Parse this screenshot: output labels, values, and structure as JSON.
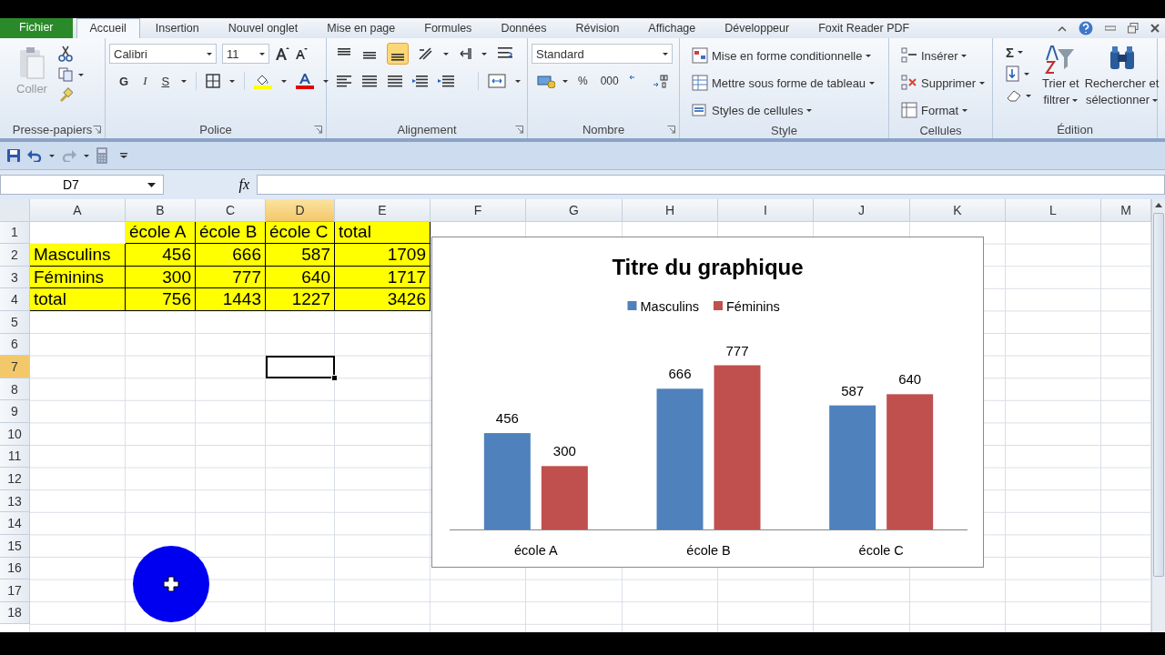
{
  "tabs": [
    {
      "label": "Fichier",
      "kind": "file",
      "selected": false
    },
    {
      "label": "Accueil",
      "kind": "tab",
      "selected": true
    },
    {
      "label": "Insertion",
      "kind": "tab",
      "selected": false
    },
    {
      "label": "Nouvel onglet",
      "kind": "tab",
      "selected": false
    },
    {
      "label": "Mise en page",
      "kind": "tab",
      "selected": false
    },
    {
      "label": "Formules",
      "kind": "tab",
      "selected": false
    },
    {
      "label": "Données",
      "kind": "tab",
      "selected": false
    },
    {
      "label": "Révision",
      "kind": "tab",
      "selected": false
    },
    {
      "label": "Affichage",
      "kind": "tab",
      "selected": false
    },
    {
      "label": "Développeur",
      "kind": "tab",
      "selected": false
    },
    {
      "label": "Foxit Reader PDF",
      "kind": "tab",
      "selected": false
    }
  ],
  "ribbon": [
    {
      "kind": "clipboard",
      "label": "Presse-papiers",
      "paste": {
        "label": "Coller",
        "disabled": true
      }
    },
    {
      "kind": "font",
      "label": "Police",
      "font": "Calibri",
      "size": "11",
      "styles": [
        "G",
        "I",
        "S"
      ]
    },
    {
      "kind": "alignment",
      "label": "Alignement"
    },
    {
      "kind": "number",
      "label": "Nombre",
      "format": "Standard",
      "symbols": [
        "%",
        "000"
      ]
    },
    {
      "kind": "styles",
      "label": "Style",
      "items": [
        "Mise en forme conditionnelle",
        "Mettre sous forme de tableau",
        "Styles de cellules"
      ]
    },
    {
      "kind": "cells",
      "label": "Cellules",
      "items": [
        "Insérer",
        "Supprimer",
        "Format"
      ]
    },
    {
      "kind": "editing",
      "label": "Édition",
      "sum": "Σ",
      "buttons": [
        {
          "lines": [
            "Trier et",
            "filtrer"
          ]
        },
        {
          "lines": [
            "Rechercher et",
            "sélectionner"
          ]
        }
      ]
    }
  ],
  "formula_bar": {
    "name_box": "D7",
    "function_label": "fx"
  },
  "sheet": {
    "columns": [
      {
        "label": "A",
        "selected": false
      },
      {
        "label": "B",
        "selected": false
      },
      {
        "label": "C",
        "selected": false
      },
      {
        "label": "D",
        "selected": true
      },
      {
        "label": "E",
        "selected": false
      },
      {
        "label": "F",
        "selected": false
      },
      {
        "label": "G",
        "selected": false
      },
      {
        "label": "H",
        "selected": false
      },
      {
        "label": "I",
        "selected": false
      },
      {
        "label": "J",
        "selected": false
      },
      {
        "label": "K",
        "selected": false
      },
      {
        "label": "L",
        "selected": false
      },
      {
        "label": "M",
        "selected": false
      }
    ],
    "rows": [
      {
        "label": "1",
        "selected": false,
        "cells": [
          {
            "filled": false
          },
          {
            "text": "école A",
            "kind": "text",
            "filled": true
          },
          {
            "text": "école B",
            "kind": "text",
            "filled": true
          },
          {
            "text": "école C",
            "kind": "text",
            "filled": true
          },
          {
            "text": "total",
            "kind": "text",
            "filled": true
          }
        ]
      },
      {
        "label": "2",
        "selected": false,
        "cells": [
          {
            "text": "Masculins",
            "kind": "text",
            "filled": true
          },
          {
            "text": "456",
            "kind": "number",
            "filled": true
          },
          {
            "text": "666",
            "kind": "number",
            "filled": true
          },
          {
            "text": "587",
            "kind": "number",
            "filled": true
          },
          {
            "text": "1709",
            "kind": "number",
            "filled": true
          }
        ]
      },
      {
        "label": "3",
        "selected": false,
        "cells": [
          {
            "text": "Féminins",
            "kind": "text",
            "filled": true
          },
          {
            "text": "300",
            "kind": "number",
            "filled": true
          },
          {
            "text": "777",
            "kind": "number",
            "filled": true
          },
          {
            "text": "640",
            "kind": "number",
            "filled": true
          },
          {
            "text": "1717",
            "kind": "number",
            "filled": true
          }
        ]
      },
      {
        "label": "4",
        "selected": false,
        "cells": [
          {
            "text": "total",
            "kind": "text",
            "filled": true
          },
          {
            "text": "756",
            "kind": "number",
            "filled": true
          },
          {
            "text": "1443",
            "kind": "number",
            "filled": true
          },
          {
            "text": "1227",
            "kind": "number",
            "filled": true
          },
          {
            "text": "3426",
            "kind": "number",
            "filled": true
          }
        ]
      },
      {
        "label": "5",
        "selected": false
      },
      {
        "label": "6",
        "selected": false
      },
      {
        "label": "7",
        "selected": true
      },
      {
        "label": "8",
        "selected": false
      },
      {
        "label": "9",
        "selected": false
      },
      {
        "label": "10",
        "selected": false
      },
      {
        "label": "11",
        "selected": false
      },
      {
        "label": "12",
        "selected": false
      },
      {
        "label": "13",
        "selected": false
      },
      {
        "label": "14",
        "selected": false
      },
      {
        "label": "15",
        "selected": false
      },
      {
        "label": "16",
        "selected": false
      },
      {
        "label": "17",
        "selected": false
      },
      {
        "label": "18",
        "selected": false
      }
    ]
  },
  "chart": {
    "chart_data": {
      "type": "bar",
      "title": "Titre du graphique",
      "categories": [
        "école A",
        "école B",
        "école C"
      ],
      "series": [
        {
          "name": "Masculins",
          "color": "#4f81bd",
          "values": [
            456,
            666,
            587
          ]
        },
        {
          "name": "Féminins",
          "color": "#c0504d",
          "values": [
            300,
            777,
            640
          ]
        }
      ],
      "legend": "top",
      "data_labels": true
    }
  },
  "pointer": {
    "kind": "highlight"
  }
}
